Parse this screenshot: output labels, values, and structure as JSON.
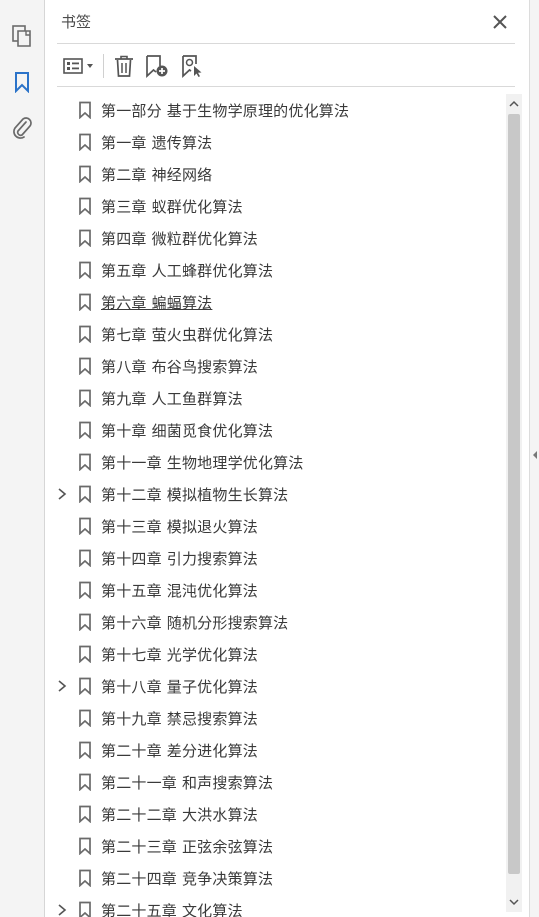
{
  "rail": {
    "icons": [
      "pages-icon",
      "bookmark-icon",
      "attachment-icon"
    ]
  },
  "panel": {
    "title": "书签",
    "close_label": "✕"
  },
  "toolbar": {
    "buttons": [
      "options-menu-icon",
      "delete-bookmark-icon",
      "new-bookmark-icon",
      "find-bookmark-icon"
    ]
  },
  "bookmarks": [
    {
      "label": "第一部分  基于生物学原理的优化算法",
      "expandable": false
    },
    {
      "label": "第一章  遗传算法",
      "expandable": false
    },
    {
      "label": "第二章  神经网络",
      "expandable": false
    },
    {
      "label": "第三章  蚁群优化算法",
      "expandable": false
    },
    {
      "label": "第四章  微粒群优化算法",
      "expandable": false
    },
    {
      "label": "第五章  人工蜂群优化算法",
      "expandable": false
    },
    {
      "label": "第六章  蝙蝠算法",
      "expandable": false,
      "underlined": true
    },
    {
      "label": "第七章  萤火虫群优化算法",
      "expandable": false
    },
    {
      "label": "第八章  布谷鸟搜索算法",
      "expandable": false
    },
    {
      "label": "第九章  人工鱼群算法",
      "expandable": false
    },
    {
      "label": "第十章  细菌觅食优化算法",
      "expandable": false
    },
    {
      "label": "第十一章  生物地理学优化算法",
      "expandable": false
    },
    {
      "label": "第十二章  模拟植物生长算法",
      "expandable": true
    },
    {
      "label": "第十三章  模拟退火算法",
      "expandable": false
    },
    {
      "label": "第十四章  引力搜索算法",
      "expandable": false
    },
    {
      "label": "第十五章  混沌优化算法",
      "expandable": false
    },
    {
      "label": "第十六章  随机分形搜索算法",
      "expandable": false
    },
    {
      "label": "第十七章  光学优化算法",
      "expandable": false
    },
    {
      "label": "第十八章  量子优化算法",
      "expandable": true
    },
    {
      "label": "第十九章  禁忌搜索算法",
      "expandable": false
    },
    {
      "label": "第二十章  差分进化算法",
      "expandable": false
    },
    {
      "label": "第二十一章  和声搜索算法",
      "expandable": false
    },
    {
      "label": "第二十二章  大洪水算法",
      "expandable": false
    },
    {
      "label": "第二十三章  正弦余弦算法",
      "expandable": false
    },
    {
      "label": "第二十四章  竞争决策算法",
      "expandable": false
    },
    {
      "label": "第二十五章  文化算法",
      "expandable": true
    }
  ],
  "colors": {
    "accent": "#2b73c9",
    "icon": "#6a6a6a",
    "text": "#3a3a3a"
  }
}
